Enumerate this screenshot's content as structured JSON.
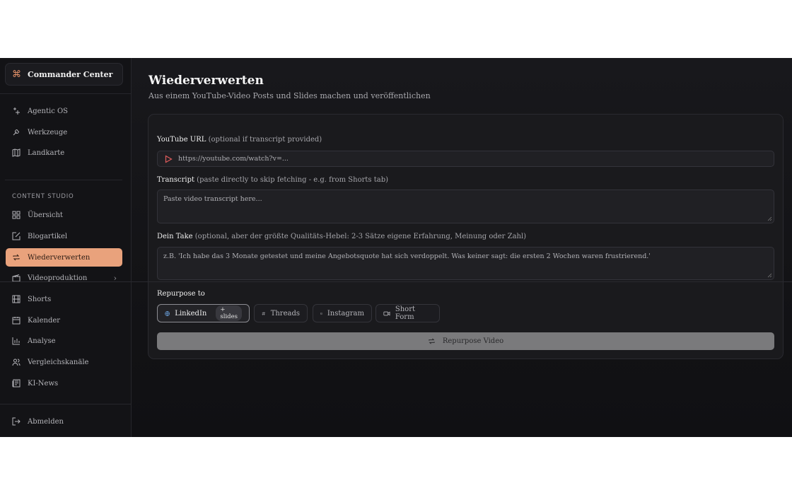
{
  "brand": {
    "title": "Commander Center"
  },
  "nav_top": [
    {
      "label": "Agentic OS"
    },
    {
      "label": "Werkzeuge"
    },
    {
      "label": "Landkarte"
    }
  ],
  "section_label": "CONTENT STUDIO",
  "nav_studio": [
    {
      "label": "Übersicht"
    },
    {
      "label": "Blogartikel"
    },
    {
      "label": "Wiederverwerten"
    },
    {
      "label": "Videoproduktion"
    },
    {
      "label": "Shorts"
    },
    {
      "label": "Kalender"
    },
    {
      "label": "Analyse"
    },
    {
      "label": "Vergleichskanäle"
    },
    {
      "label": "KI-News"
    }
  ],
  "logout": {
    "label": "Abmelden"
  },
  "page": {
    "title": "Wiederverwerten",
    "subtitle": "Aus einem YouTube-Video Posts und Slides machen und veröffentlichen"
  },
  "form": {
    "youtube": {
      "label": "YouTube URL",
      "hint": "(optional if transcript provided)",
      "placeholder": "https://youtube.com/watch?v=..."
    },
    "transcript": {
      "label": "Transcript",
      "hint": "(paste directly to skip fetching - e.g. from Shorts tab)",
      "placeholder": "Paste video transcript here..."
    },
    "take": {
      "label": "Dein Take",
      "hint": "(optional, aber der größte Qualitäts-Hebel: 2-3 Sätze eigene Erfahrung, Meinung oder Zahl)",
      "placeholder": "z.B. 'Ich habe das 3 Monate getestet und meine Angebotsquote hat sich verdoppelt. Was keiner sagt: die ersten 2 Wochen waren frustrierend.'"
    },
    "repurpose_label": "Repurpose to",
    "targets": [
      {
        "label": "LinkedIn",
        "badge": "+ slides",
        "selected": true,
        "icon": "globe-icon"
      },
      {
        "label": "Threads",
        "selected": false,
        "icon": "hash-icon"
      },
      {
        "label": "Instagram",
        "selected": false,
        "icon": "image-icon"
      },
      {
        "label": "Short Form",
        "selected": false,
        "icon": "video-icon"
      }
    ],
    "submit_label": "Repurpose Video"
  },
  "colors": {
    "accent": "#e9a27c",
    "background": "#131316",
    "card": "#1a1a1d",
    "button": "#7a7a7c"
  }
}
